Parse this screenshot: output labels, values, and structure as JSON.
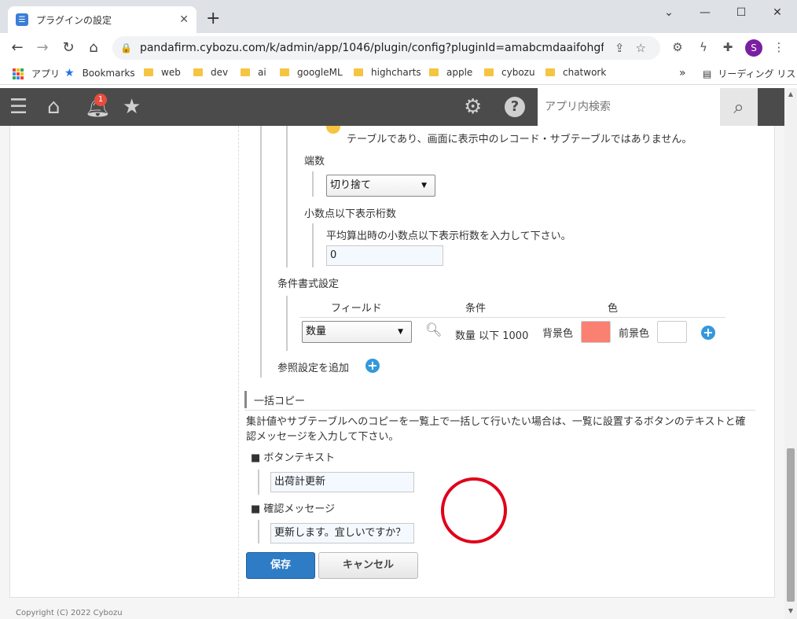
{
  "browser": {
    "tab_title": "プラグインの設定",
    "url": "pandafirm.cybozu.com/k/admin/app/1046/plugin/config?pluginId=amabcmdaaifohgfnkkkfed...",
    "profile_initial": "S",
    "bookmarks": [
      "アプリ",
      "Bookmarks",
      "web",
      "dev",
      "ai",
      "googleML",
      "highcharts",
      "apple",
      "cybozu",
      "chatwork"
    ],
    "reading_list": "リーディング リスト"
  },
  "header": {
    "notification_count": "1",
    "search_placeholder": "アプリ内検索"
  },
  "form": {
    "note_text": "テーブルであり、画面に表示中のレコード・サブテーブルではありません。",
    "rounding_label": "端数",
    "rounding_value": "切り捨て",
    "decimals_label": "小数点以下表示桁数",
    "decimals_help": "平均算出時の小数点以下表示桁数を入力して下さい。",
    "decimals_value": "0",
    "condition_title": "条件書式設定",
    "condition_headers": [
      "フィールド",
      "条件",
      "色"
    ],
    "condition_field": "数量",
    "condition_text": "数量 以下 1000",
    "bg_label": "背景色",
    "bg_color": "#fa8072",
    "fg_label": "前景色",
    "fg_color": "#ffffff",
    "add_reference": "参照設定を追加"
  },
  "bulk_copy": {
    "title": "一括コピー",
    "description_1": "集計値やサブテーブルへのコピーを一覧上で一括して行いたい場合は、一覧に設置するボタンのテキストと確",
    "description_2": "認メッセージを入力して下さい。",
    "button_text_label": "■ ボタンテキスト",
    "button_text_value": "出荷計更新",
    "confirm_label": "■ 確認メッセージ",
    "confirm_value": "更新します。宜しいですか？"
  },
  "actions": {
    "save": "保存",
    "cancel": "キャンセル"
  },
  "footer": {
    "copyright": "Copyright (C) 2022 Cybozu"
  },
  "colors": {
    "header_bg": "#4b4b4b",
    "primary_button": "#2f7cc6",
    "accent_plus": "#3498db",
    "annotation_circle": "#e0001a"
  }
}
